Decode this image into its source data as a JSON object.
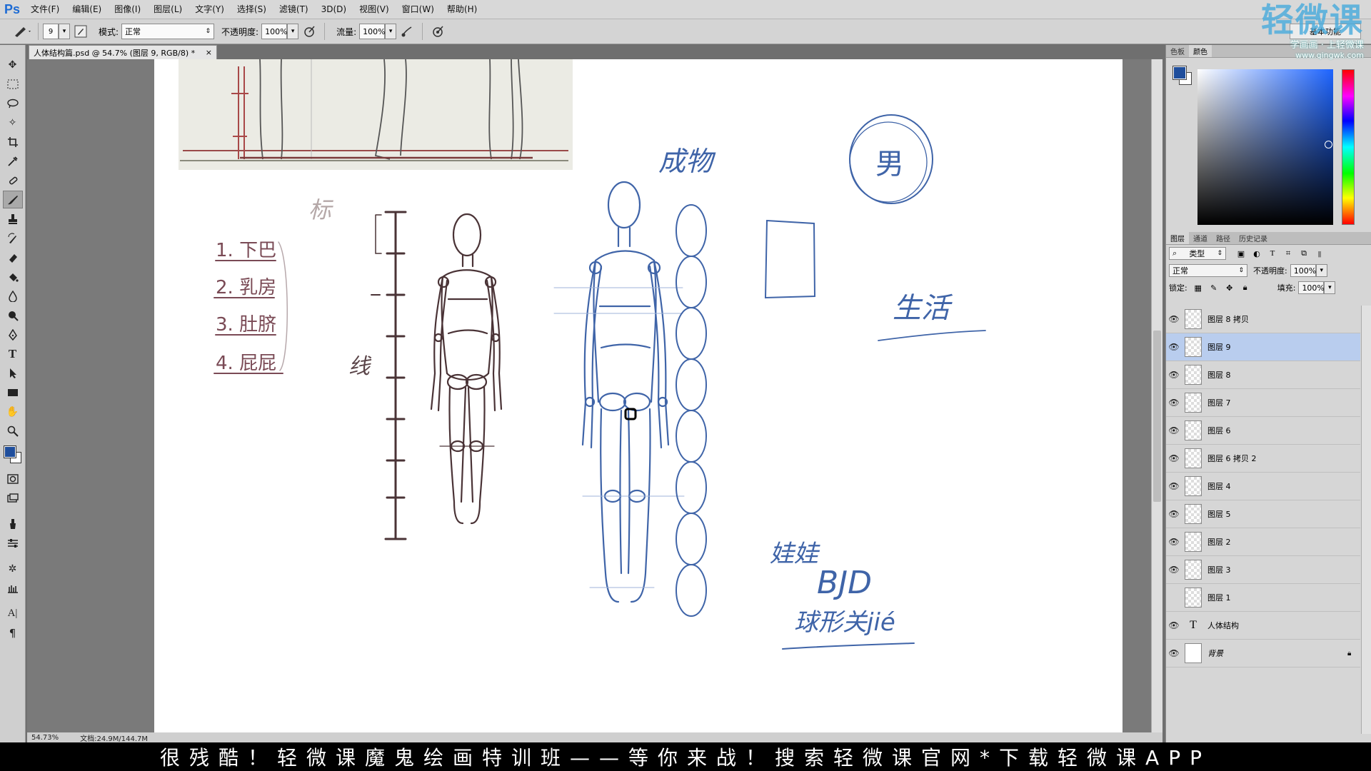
{
  "app": {
    "logo": "Ps",
    "menus": [
      "文件(F)",
      "编辑(E)",
      "图像(I)",
      "图层(L)",
      "文字(Y)",
      "选择(S)",
      "滤镜(T)",
      "3D(D)",
      "视图(V)",
      "窗口(W)",
      "帮助(H)"
    ]
  },
  "options": {
    "brush_size": "9",
    "mode_label": "模式:",
    "mode_value": "正常",
    "opacity_label": "不透明度:",
    "opacity_value": "100%",
    "flow_label": "流量:",
    "flow_value": "100%",
    "workspace": "基本功能"
  },
  "document": {
    "tab_title": "人体结构篇.psd @ 54.7% (图层 9, RGB/8) *",
    "close": "×"
  },
  "canvas": {
    "labels": {
      "biao": "标",
      "list_1": "1. 下巴",
      "list_2": "2. 乳房",
      "list_3": "3. 肚脐",
      "list_4": "4. 屁屁",
      "xian": "线",
      "chengwu": "成物",
      "nan": "男",
      "shenghuo": "生活",
      "wawa": "娃娃",
      "bjd": "BJD",
      "qiuxing": "球形关jié"
    },
    "colors": {
      "blue": "#3f64a8",
      "dark": "#4a3336",
      "maroon": "#7a4a55"
    }
  },
  "panels": {
    "color_tabs": [
      "色板",
      "颜色"
    ],
    "layers_tabs": [
      "图层",
      "通道",
      "路径",
      "历史记录"
    ],
    "filter_kind": "类型",
    "blend_mode": "正常",
    "opacity_label": "不透明度:",
    "opacity_value": "100%",
    "lock_label": "锁定:",
    "fill_label": "填充:",
    "fill_value": "100%",
    "layers": [
      {
        "name": "图层 8 拷贝",
        "visible": true,
        "selected": false,
        "kind": "pixel"
      },
      {
        "name": "图层 9",
        "visible": true,
        "selected": true,
        "kind": "pixel"
      },
      {
        "name": "图层 8",
        "visible": true,
        "selected": false,
        "kind": "pixel"
      },
      {
        "name": "图层 7",
        "visible": true,
        "selected": false,
        "kind": "pixel"
      },
      {
        "name": "图层 6",
        "visible": true,
        "selected": false,
        "kind": "pixel"
      },
      {
        "name": "图层 6 拷贝 2",
        "visible": true,
        "selected": false,
        "kind": "pixel"
      },
      {
        "name": "图层 4",
        "visible": true,
        "selected": false,
        "kind": "pixel"
      },
      {
        "name": "图层 5",
        "visible": true,
        "selected": false,
        "kind": "pixel"
      },
      {
        "name": "图层 2",
        "visible": true,
        "selected": false,
        "kind": "pixel"
      },
      {
        "name": "图层 3",
        "visible": true,
        "selected": false,
        "kind": "pixel"
      },
      {
        "name": "图层 1",
        "visible": false,
        "selected": false,
        "kind": "pixel"
      },
      {
        "name": "人体结构",
        "visible": true,
        "selected": false,
        "kind": "text"
      },
      {
        "name": "背景",
        "visible": true,
        "selected": false,
        "kind": "background"
      }
    ]
  },
  "watermark": {
    "title": "轻微课",
    "subtitle": "学画画 · 上轻微课",
    "url": "www.qingwk.com"
  },
  "status": {
    "zoom": "54.73%",
    "doc": "文档:24.9M/144.7M"
  },
  "banner": {
    "text": "很残酷！轻微课魔鬼绘画特训班——等你来战！搜索轻微课官网*下载轻微课APP"
  }
}
